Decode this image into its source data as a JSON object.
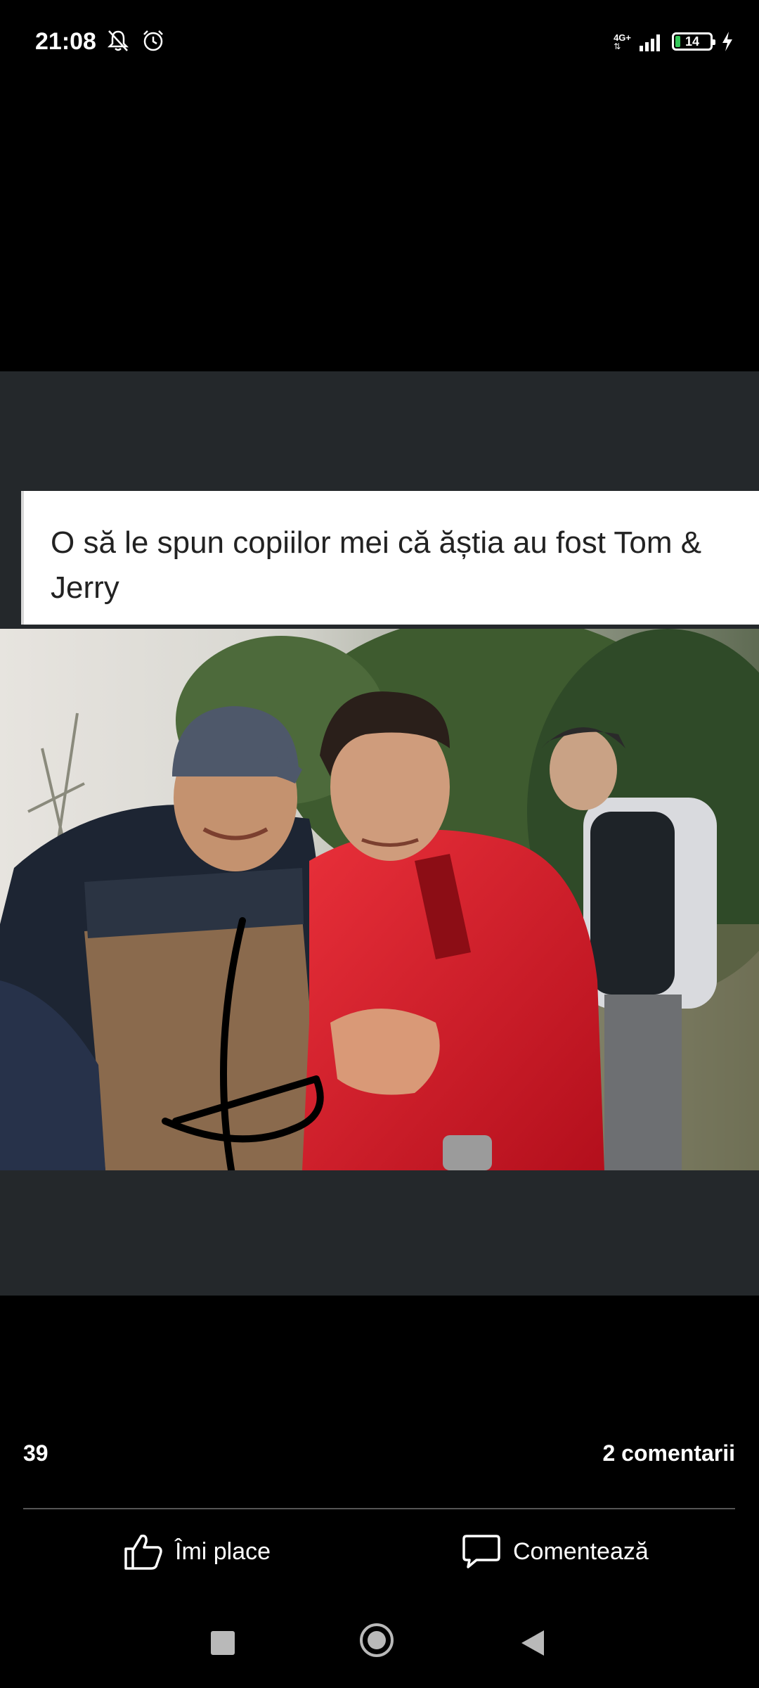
{
  "status_bar": {
    "time": "21:08",
    "network": "4G+",
    "battery_level": "14",
    "battery_fraction": 0.14,
    "icons": [
      "silent-bell-icon",
      "alarm-clock-icon",
      "signal-icon",
      "battery-icon",
      "charging-icon"
    ]
  },
  "post": {
    "caption": "O să le spun copiilor mei că ăștia au fost Tom & Jerry",
    "background_color": "#24282b"
  },
  "reactions": {
    "like_count": "39",
    "comments_count": "2 comentarii"
  },
  "actions": {
    "like_label": "Îmi place",
    "comment_label": "Comentează"
  },
  "nav": {
    "icons": [
      "recents-icon",
      "home-icon",
      "back-icon"
    ]
  }
}
